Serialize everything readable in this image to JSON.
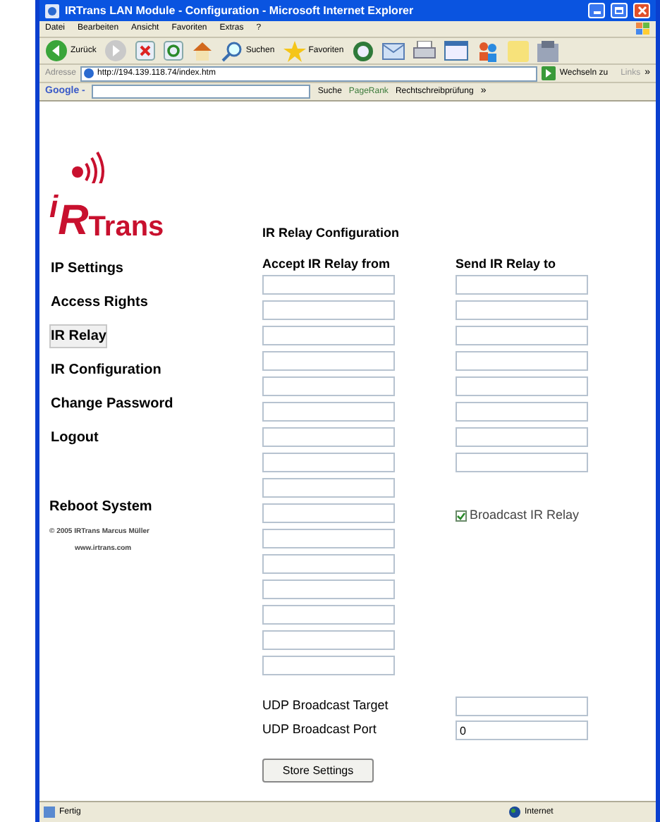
{
  "window": {
    "title": "IRTrans LAN Module - Configuration - Microsoft Internet Explorer"
  },
  "menu": [
    "Datei",
    "Bearbeiten",
    "Ansicht",
    "Favoriten",
    "Extras",
    "?"
  ],
  "toolbar": [
    {
      "kind": "back",
      "label": "Zurück"
    },
    {
      "kind": "forward"
    },
    {
      "kind": "stop"
    },
    {
      "kind": "refresh"
    },
    {
      "kind": "home"
    },
    {
      "kind": "search",
      "label": "Suchen"
    },
    {
      "kind": "favorites",
      "label": "Favoriten"
    },
    {
      "kind": "history"
    },
    {
      "kind": "mail"
    },
    {
      "kind": "print"
    },
    {
      "kind": "edit"
    },
    {
      "kind": "messenger"
    },
    {
      "kind": "folder"
    },
    {
      "kind": "tool"
    }
  ],
  "address_bar": {
    "label": "Adresse",
    "url": "http://194.139.118.74/index.htm",
    "go": "Wechseln zu",
    "links": "Links",
    "more": "»"
  },
  "google_bar": {
    "brand": "Google -",
    "search": "Suche",
    "pagerank": "PageRank",
    "spell": "Rechtschreibprüfung",
    "more": "»"
  },
  "logo": {
    "parts": [
      "i",
      "R",
      "Trans"
    ]
  },
  "nav": [
    {
      "label": "IP Settings",
      "selected": false
    },
    {
      "label": "Access Rights",
      "selected": false
    },
    {
      "label": "IR Relay",
      "selected": true
    },
    {
      "label": "IR Configuration",
      "selected": false
    },
    {
      "label": "Change Password",
      "selected": false
    },
    {
      "label": "Logout",
      "selected": false
    }
  ],
  "reboot": "Reboot System",
  "copyright": "© 2005 IRTrans Marcus Müller",
  "website": "www.irtrans.com",
  "heading": "IR Relay Configuration",
  "accept_from": {
    "label": "Accept IR Relay from",
    "fields": [
      {
        "kind": "input"
      },
      {
        "kind": "input"
      },
      {
        "kind": "input"
      },
      {
        "kind": "input"
      },
      {
        "kind": "input"
      },
      {
        "kind": "input"
      },
      {
        "kind": "input"
      },
      {
        "kind": "input"
      },
      {
        "kind": "input"
      },
      {
        "kind": "input"
      },
      {
        "kind": "input"
      },
      {
        "kind": "input"
      },
      {
        "kind": "input"
      },
      {
        "kind": "input"
      },
      {
        "kind": "input"
      },
      {
        "kind": "input"
      }
    ]
  },
  "send_to": {
    "label": "Send IR Relay to",
    "fields": [
      {
        "kind": "input"
      },
      {
        "kind": "input"
      },
      {
        "kind": "input"
      },
      {
        "kind": "input"
      },
      {
        "kind": "input"
      },
      {
        "kind": "input"
      },
      {
        "kind": "input"
      },
      {
        "kind": "input"
      }
    ]
  },
  "broadcast": {
    "label": "Broadcast IR Relay",
    "checked": true
  },
  "udp_target": {
    "label": "UDP Broadcast Target"
  },
  "udp_port": {
    "label": "UDP Broadcast Port",
    "value": "0"
  },
  "store_button": "Store Settings",
  "status_bar": {
    "text": "Fertig",
    "zone": "Internet"
  }
}
